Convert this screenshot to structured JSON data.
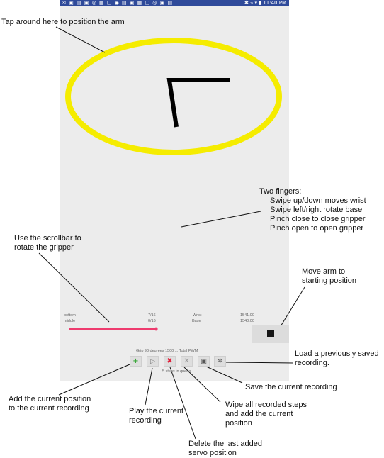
{
  "status_bar": {
    "left_icons": "✉ ▣ ▤ ▣ ◎ ▦ ▢ ◉ ▤ ▣ ▦ ▢ ◎ ▣ ▤",
    "right_text": "✱ ⌁ ▾ ▮ 11:40 PM"
  },
  "annotations": {
    "tap_area": "Tap around here to position the arm",
    "two_fingers_title": "Two fingers:",
    "gesture_wrist": "Swipe up/down moves wrist",
    "gesture_base": "Swipe left/right rotate base",
    "gesture_pinch_close": "Pinch close to close gripper",
    "gesture_pinch_open": "Pinch open to open gripper",
    "scrollbar_line1": "Use the scrollbar to",
    "scrollbar_line2": "rotate the gripper",
    "move_arm_line1": "Move arm to",
    "move_arm_line2": "starting position",
    "load_line1": "Load a previously saved",
    "load_line2": "recording.",
    "save": "Save the current recording",
    "add_line1": "Add the current position",
    "add_line2": "to the current recording",
    "play_line1": "Play the current",
    "play_line2": "recording",
    "wipe_line1": "Wipe all recorded steps",
    "wipe_line2": "and add the current",
    "wipe_line3": "position",
    "delete_line1": "Delete the last added",
    "delete_line2": "servo position"
  },
  "readouts": {
    "col1_row1": "bottom",
    "col1_row2": "middle",
    "col2_row1": "7/16",
    "col2_row2": "0/16",
    "col3_row1": "Wrist",
    "col3_row2": "Base",
    "col4_row1": "1541.00",
    "col4_row2": "1540.00"
  },
  "status_line": "Grip 90 degrees   1500 ... Total PWM",
  "steps_label": "5 steps in queue",
  "scrollbar": {
    "value_fraction": 0.97
  },
  "icons": {
    "add": "plus-icon",
    "play": "play-icon",
    "delete": "delete-icon",
    "wipe": "wipe-icon",
    "save": "save-icon",
    "load": "load-icon",
    "stop": "stop-square-icon"
  },
  "colors": {
    "status_bar": "#2f4a9a",
    "screen_bg": "#ececec",
    "ellipse": "#f5ec00",
    "arm": "#000000",
    "scrollbar": "#ee3b6e",
    "add_icon": "#3aa83a",
    "delete_icon": "#e0203a"
  }
}
